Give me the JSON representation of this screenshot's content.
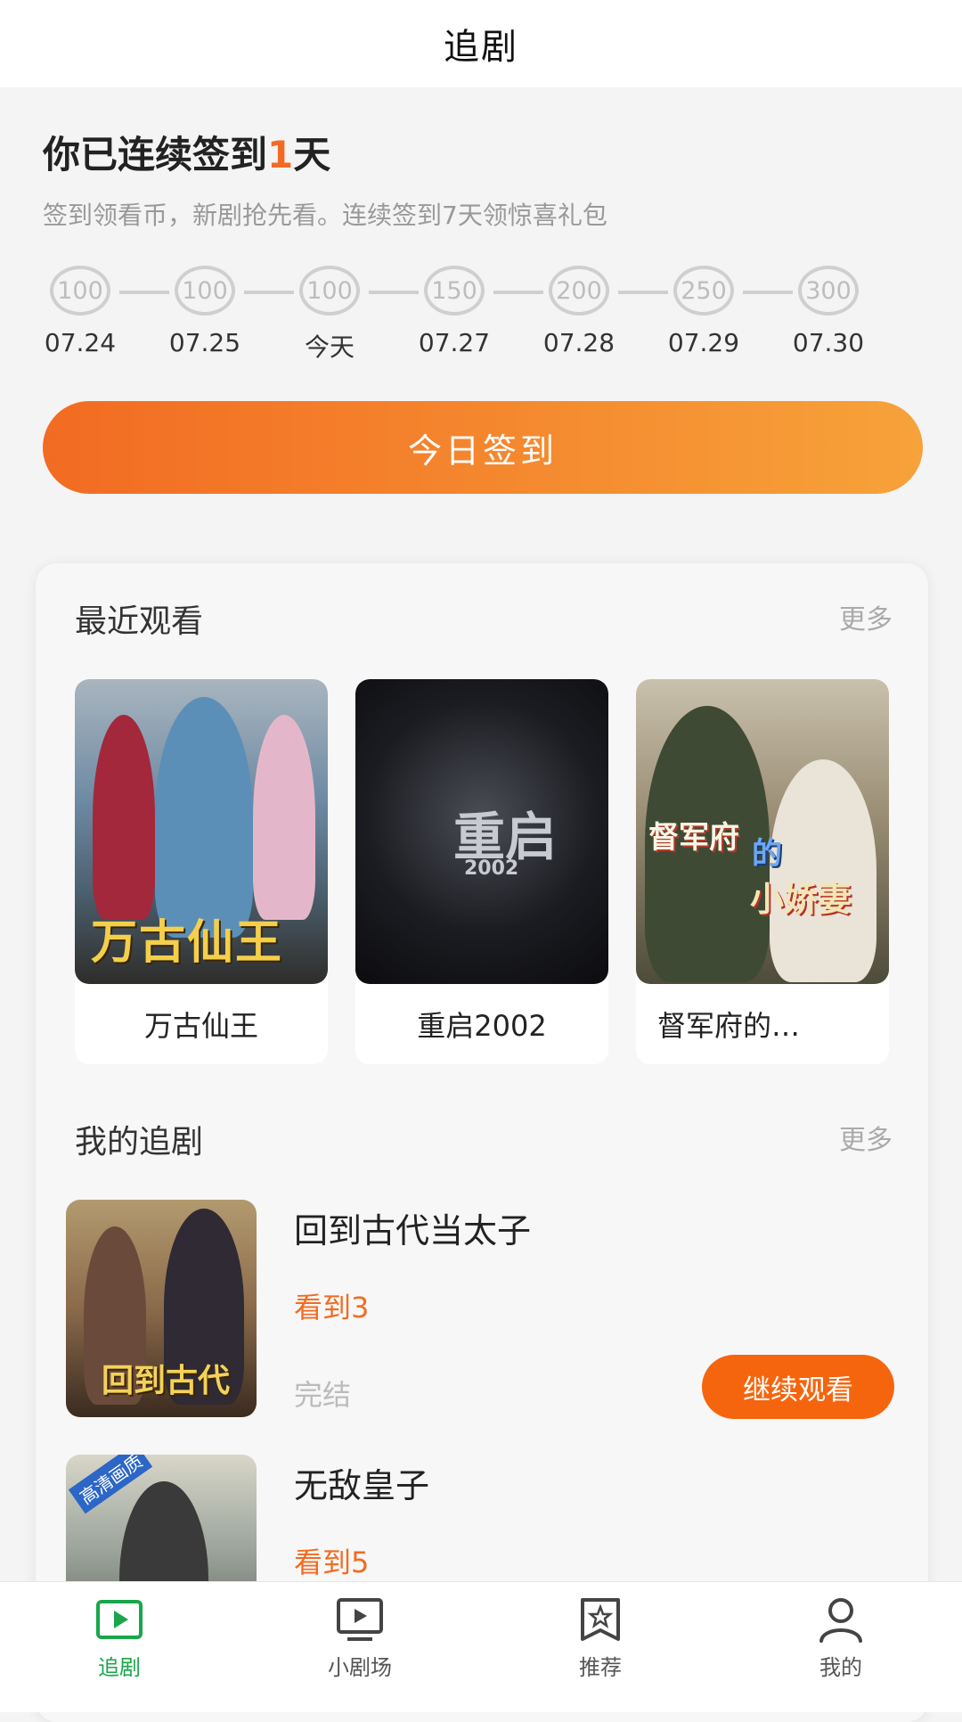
{
  "header": {
    "title": "追剧"
  },
  "signin": {
    "headline_prefix": "你已连续签到",
    "days": "1",
    "headline_suffix": "天",
    "subtitle": "签到领看币，新剧抢先看。连续签到7天领惊喜礼包",
    "days_list": [
      {
        "coins": "100",
        "date": "07.24"
      },
      {
        "coins": "100",
        "date": "07.25"
      },
      {
        "coins": "100",
        "date": "今天"
      },
      {
        "coins": "150",
        "date": "07.27"
      },
      {
        "coins": "200",
        "date": "07.28"
      },
      {
        "coins": "250",
        "date": "07.29"
      },
      {
        "coins": "300",
        "date": "07.30"
      }
    ],
    "button_label": "今日签到"
  },
  "recent": {
    "title": "最近观看",
    "more": "更多",
    "items": [
      {
        "name": "万古仙王",
        "poster_text": "万古仙王"
      },
      {
        "name": "重启2002",
        "poster_text": "重启",
        "poster_subtext": "2002"
      },
      {
        "name": "督军府的…",
        "poster_text_a": "督军府",
        "poster_text_b": "的",
        "poster_text_c": "小娇妻"
      }
    ]
  },
  "following": {
    "title": "我的追剧",
    "more": "更多",
    "items": [
      {
        "title": "回到古代当太子",
        "progress": "看到3",
        "status": "完结",
        "button": "继续观看",
        "poster_text": "回到古代"
      },
      {
        "title": "无敌皇子",
        "progress": "看到5",
        "poster_badge": "高清画质"
      }
    ]
  },
  "tabs": [
    {
      "label": "追剧",
      "icon": "play-square-icon",
      "active": true
    },
    {
      "label": "小剧场",
      "icon": "tv-play-icon",
      "active": false
    },
    {
      "label": "推荐",
      "icon": "bookmark-star-icon",
      "active": false
    },
    {
      "label": "我的",
      "icon": "user-icon",
      "active": false
    }
  ],
  "colors": {
    "accent": "#f26b22",
    "active_tab": "#19a64a"
  }
}
